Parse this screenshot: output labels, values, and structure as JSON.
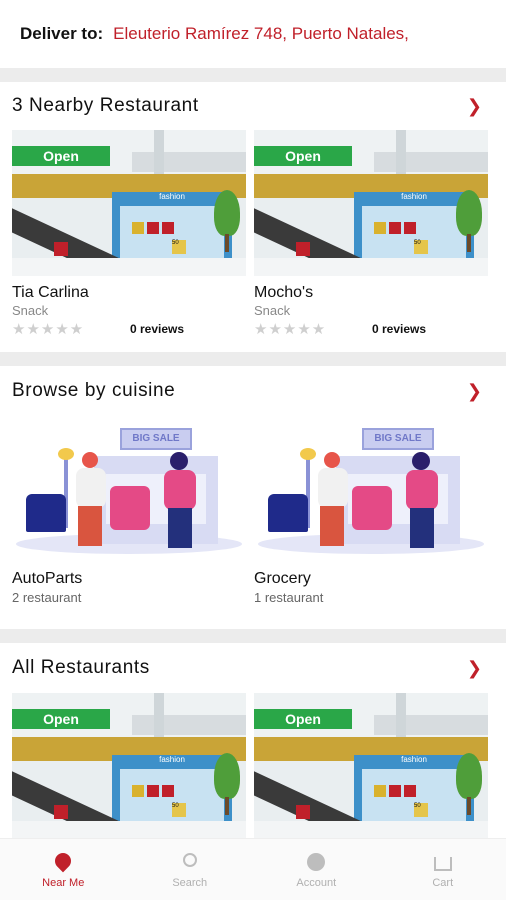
{
  "header": {
    "deliver_label": "Deliver to:",
    "address": "Eleuterio Ramírez 748, Puerto Natales,"
  },
  "nearby": {
    "title": "3 Nearby Restaurant",
    "cards": [
      {
        "open": "Open",
        "name": "Tia Carlina",
        "category": "Snack",
        "stars": "★★★★★",
        "rating": 0,
        "reviews": "0 reviews"
      },
      {
        "open": "Open",
        "name": "Mocho's",
        "category": "Snack",
        "stars": "★★★★★",
        "rating": 0,
        "reviews": "0 reviews"
      }
    ]
  },
  "cuisine": {
    "title": "Browse by cuisine",
    "cards": [
      {
        "banner": "BIG SALE",
        "name": "AutoParts",
        "count": "2 restaurant"
      },
      {
        "banner": "BIG SALE",
        "name": "Grocery",
        "count": "1 restaurant"
      }
    ]
  },
  "all": {
    "title": "All Restaurants",
    "cards": [
      {
        "open": "Open"
      },
      {
        "open": "Open"
      }
    ]
  },
  "photo_text": {
    "fashion": "fashion",
    "sale": "50"
  },
  "tabs": [
    {
      "label": "Near Me",
      "icon": "map-pin-icon",
      "active": true
    },
    {
      "label": "Search",
      "icon": "search-icon",
      "active": false
    },
    {
      "label": "Account",
      "icon": "account-icon",
      "active": false
    },
    {
      "label": "Cart",
      "icon": "cart-icon",
      "active": false
    }
  ],
  "colors": {
    "accent": "#c0202a",
    "open_badge": "#2aa748",
    "separator": "#ececec"
  }
}
